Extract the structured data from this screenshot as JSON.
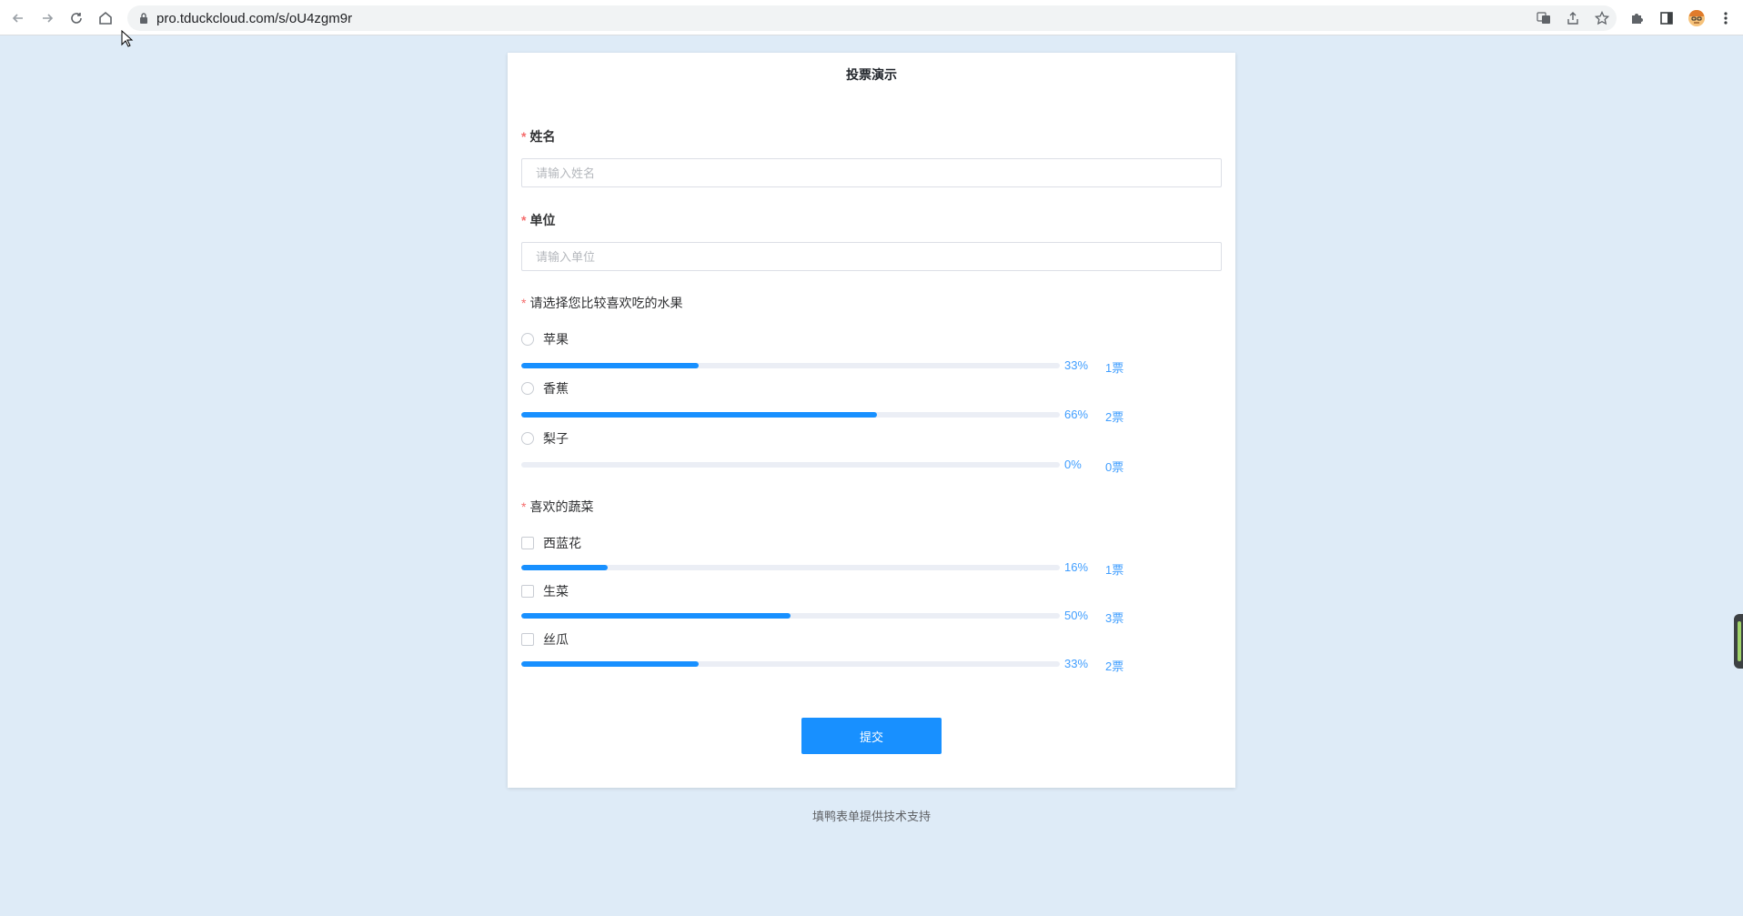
{
  "browser": {
    "url": "pro.tduckcloud.com/s/oU4zgm9r"
  },
  "form": {
    "title": "投票演示",
    "name_field": {
      "label": "姓名",
      "placeholder": "请输入姓名",
      "required_mark": "*"
    },
    "unit_field": {
      "label": "单位",
      "placeholder": "请输入单位",
      "required_mark": "*"
    },
    "fruit_question": {
      "required_mark": "*",
      "label": "请选择您比较喜欢吃的水果",
      "options": [
        {
          "label": "苹果",
          "percent": 33,
          "percent_text": "33%",
          "votes_text": "1票"
        },
        {
          "label": "香蕉",
          "percent": 66,
          "percent_text": "66%",
          "votes_text": "2票"
        },
        {
          "label": "梨子",
          "percent": 0,
          "percent_text": "0%",
          "votes_text": "0票"
        }
      ]
    },
    "veg_question": {
      "required_mark": "*",
      "label": "喜欢的蔬菜",
      "options": [
        {
          "label": "西蓝花",
          "percent": 16,
          "percent_text": "16%",
          "votes_text": "1票"
        },
        {
          "label": "生菜",
          "percent": 50,
          "percent_text": "50%",
          "votes_text": "3票"
        },
        {
          "label": "丝瓜",
          "percent": 33,
          "percent_text": "33%",
          "votes_text": "2票"
        }
      ]
    },
    "submit_label": "提交"
  },
  "footer": {
    "text": "填鸭表单提供技术支持"
  },
  "colors": {
    "accent": "#1890ff",
    "background": "#deebf7",
    "required": "#f56c6c"
  }
}
